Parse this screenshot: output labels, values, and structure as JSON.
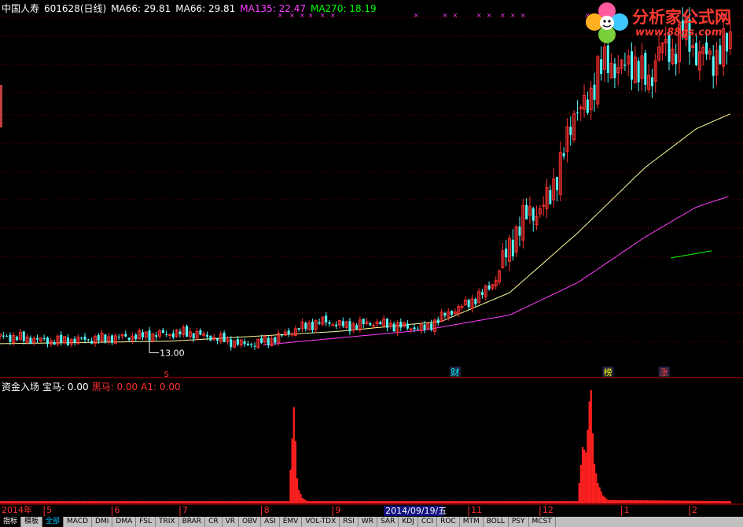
{
  "header": {
    "stock": "中国人寿",
    "code_period": "601628(日线)",
    "ma1": "MA66: 29.81",
    "ma2": "MA66: 29.81",
    "ma3": "MA135: 22.47",
    "ma4": "MA270: 18.19"
  },
  "logo": {
    "title": "分析家公式网",
    "url": "www.88gs.com"
  },
  "indicator": {
    "name": "资金入场",
    "bm": "宝马: 0.00",
    "hm": "黑马: 0.00",
    "a1": "A1: 0.00"
  },
  "annotations": {
    "low_price": "13.00",
    "marker_s": "S",
    "event1": "财",
    "event2": "榜",
    "event3": "涨"
  },
  "x_axis": {
    "start": "2014年",
    "months": [
      "5",
      "6",
      "7",
      "8",
      "9",
      "11",
      "12",
      "1",
      "2"
    ],
    "selected_date": "2014/09/19/五"
  },
  "tabs": [
    "指标",
    "模板",
    "全部",
    "MACD",
    "DMI",
    "DMA",
    "FSL",
    "TRIX",
    "BRAR",
    "CR",
    "VR",
    "OBV",
    "ASI",
    "EMV",
    "VOL-TDX",
    "RSI",
    "WR",
    "SAR",
    "KDJ",
    "CCI",
    "ROC",
    "MTM",
    "BOLL",
    "PSY",
    "MCST"
  ],
  "colors": {
    "up": "#ff3232",
    "down": "#54fcfc",
    "ma66": "#ffff9c",
    "ma135": "#ff40ff",
    "ma270": "#00ff00",
    "label_white": "#ffffff",
    "label_cyan": "#00ffff",
    "label_magenta": "#ff40ff",
    "label_green": "#00ff00",
    "red": "#ff2020"
  },
  "chart_data": [
    {
      "type": "candlestick",
      "title": "中国人寿 601628(日线)",
      "ylim": [
        11,
        40
      ],
      "price_points": [
        [
          0,
          14.2
        ],
        [
          30,
          13.8
        ],
        [
          60,
          14.0
        ],
        [
          90,
          14.3
        ],
        [
          110,
          14.5
        ],
        [
          125,
          14.1
        ],
        [
          145,
          13.5
        ],
        [
          160,
          13.9
        ],
        [
          175,
          14.8
        ],
        [
          190,
          15.4
        ],
        [
          205,
          15.0
        ],
        [
          220,
          15.3
        ],
        [
          235,
          15.0
        ],
        [
          250,
          14.8
        ],
        [
          262,
          15.9
        ],
        [
          275,
          16.8
        ],
        [
          285,
          17.7
        ],
        [
          292,
          18.8
        ],
        [
          300,
          21.5
        ],
        [
          305,
          22.7
        ],
        [
          312,
          24.4
        ],
        [
          318,
          24.0
        ],
        [
          330,
          27.8
        ],
        [
          338,
          32.4
        ],
        [
          346,
          32.6
        ],
        [
          352,
          35.9
        ],
        [
          360,
          36.0
        ],
        [
          368,
          35.8
        ],
        [
          374,
          36.3
        ],
        [
          382,
          34.3
        ],
        [
          388,
          37.7
        ],
        [
          395,
          36.7
        ],
        [
          402,
          38.9
        ],
        [
          410,
          37.0
        ],
        [
          420,
          36.5
        ],
        [
          430,
          37.9
        ]
      ],
      "ma66": [
        [
          0,
          13.6
        ],
        [
          100,
          13.8
        ],
        [
          200,
          14.6
        ],
        [
          260,
          15.4
        ],
        [
          300,
          17.7
        ],
        [
          340,
          22.5
        ],
        [
          380,
          27.8
        ],
        [
          410,
          30.9
        ],
        [
          430,
          32.1
        ]
      ],
      "ma135": [
        [
          155,
          13.5
        ],
        [
          250,
          14.7
        ],
        [
          300,
          15.9
        ],
        [
          340,
          18.5
        ],
        [
          380,
          22.2
        ],
        [
          410,
          24.6
        ],
        [
          430,
          25.5
        ]
      ],
      "ma270": [
        [
          395,
          20.5
        ],
        [
          420,
          21.1
        ]
      ],
      "low_label_value": 13.0
    },
    {
      "type": "bar",
      "title": "资金入场",
      "ylim": [
        0,
        1.0
      ],
      "spikes": [
        [
          0,
          0.02
        ],
        [
          170,
          0.02
        ],
        [
          173,
          0.85
        ],
        [
          174,
          0.55
        ],
        [
          175,
          0.22
        ],
        [
          176,
          0.12
        ],
        [
          178,
          0.05
        ],
        [
          181,
          0.02
        ],
        [
          340,
          0.02
        ],
        [
          343,
          0.5
        ],
        [
          345,
          0.45
        ],
        [
          346,
          0.65
        ],
        [
          347,
          0.9
        ],
        [
          348,
          1.0
        ],
        [
          349,
          0.62
        ],
        [
          350,
          0.35
        ],
        [
          352,
          0.18
        ],
        [
          355,
          0.07
        ],
        [
          358,
          0.03
        ],
        [
          430,
          0.02
        ]
      ]
    }
  ]
}
